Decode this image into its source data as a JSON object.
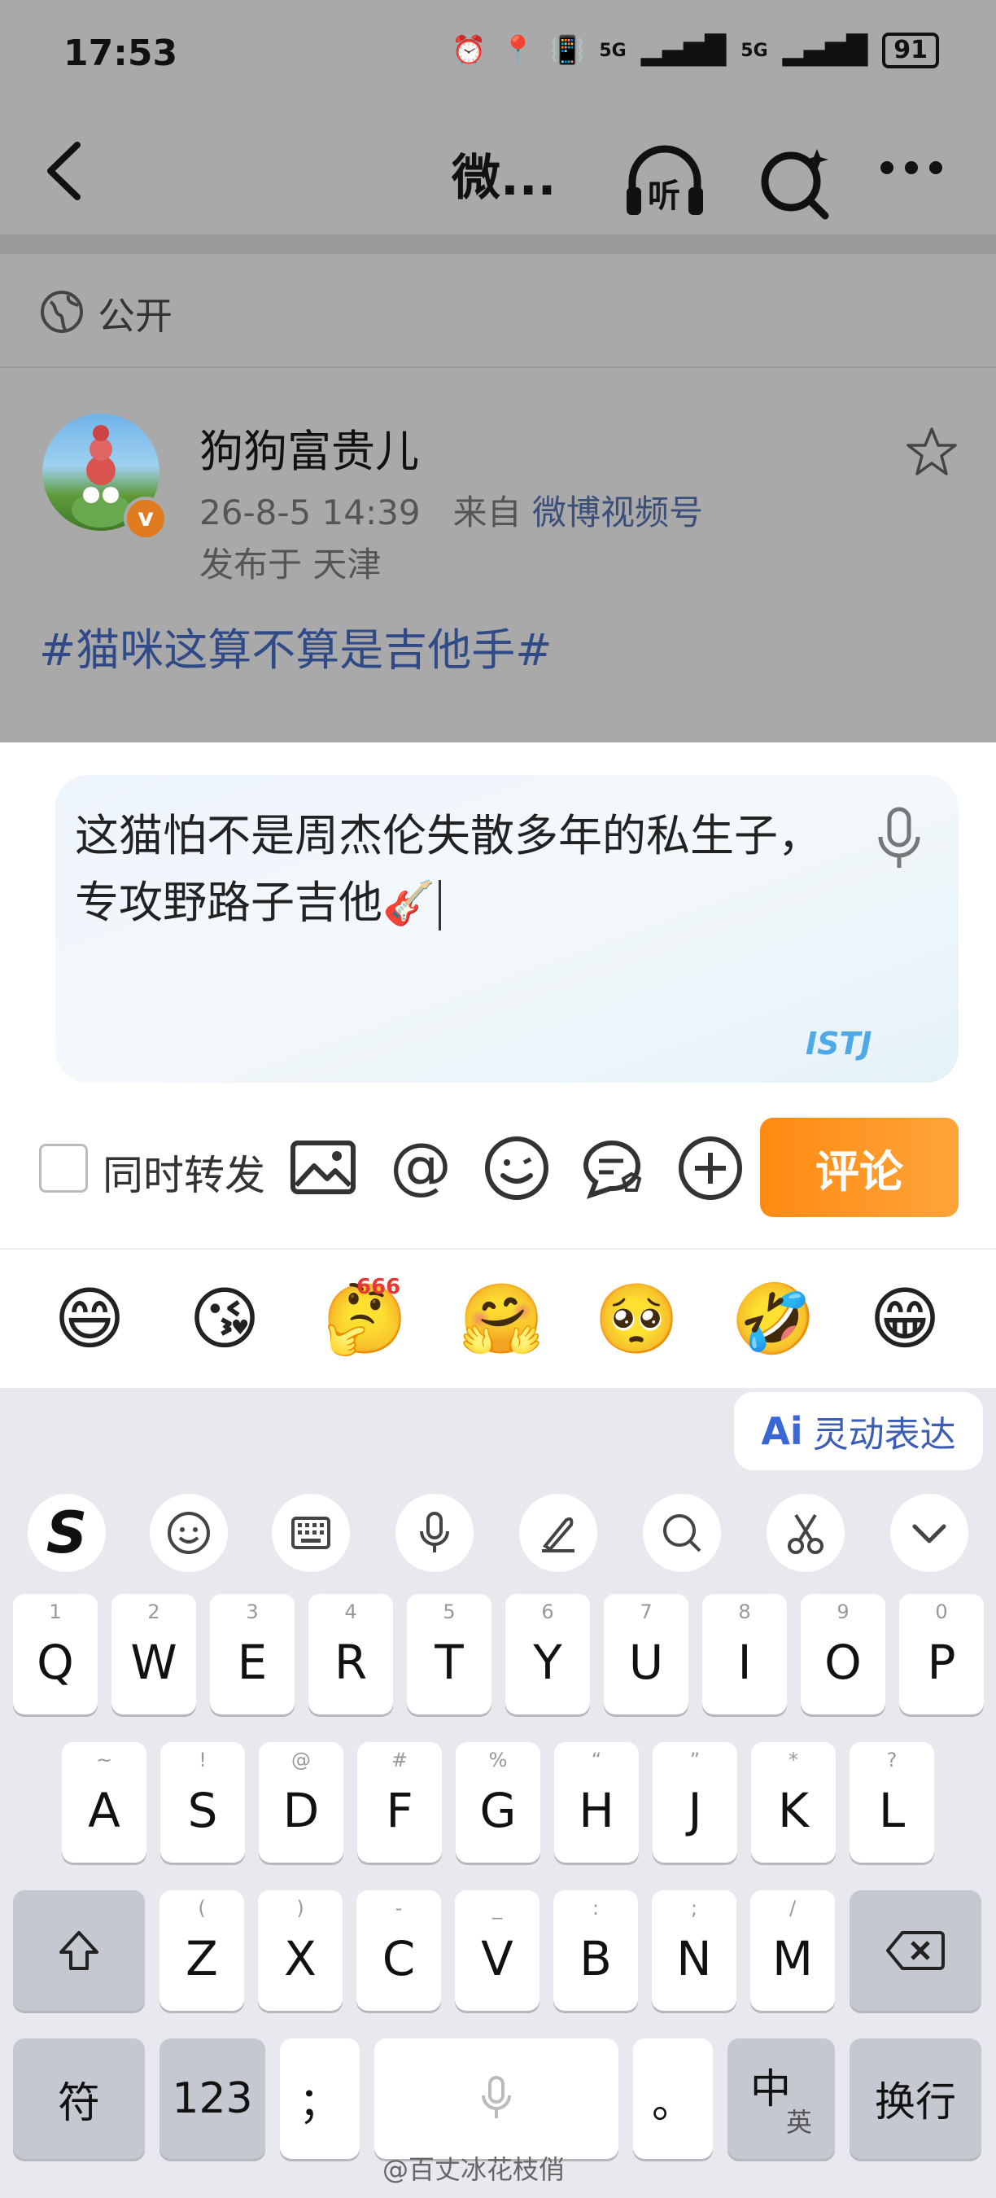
{
  "status_bar": {
    "time": "17:53",
    "signal1": "5G",
    "signal2": "5G",
    "battery": "91"
  },
  "nav": {
    "title": "微...",
    "listen_label": "听"
  },
  "post": {
    "visibility": "公开",
    "username": "狗狗富贵儿",
    "date": "26-8-5 14:39",
    "from_prefix": "来自",
    "source": "微博视频号",
    "location": "发布于 天津",
    "hashtag": "#猫咪这算不算是吉他手#"
  },
  "composer": {
    "text": "这猫怕不是周杰伦失散多年的私生子，专攻野路子吉他",
    "emoji": "🎸",
    "badge": "ISTJ",
    "repost_label": "同时转发",
    "repost_checked": false,
    "submit_label": "评论"
  },
  "emoji_bar": [
    "😄",
    "😘",
    "🤔",
    "🤗",
    "🥺",
    "🤣",
    "😁"
  ],
  "emoji_badge": "666",
  "keyboard": {
    "ai_label": "灵动表达",
    "ai_icon": "Ai",
    "toolbar_icons": [
      "sogou-logo-icon",
      "emoji-icon",
      "keyboard-icon",
      "mic-icon",
      "handwriting-icon",
      "search-icon",
      "scissors-icon",
      "chevron-down-icon"
    ],
    "row1": [
      {
        "k": "Q",
        "h": "1"
      },
      {
        "k": "W",
        "h": "2"
      },
      {
        "k": "E",
        "h": "3"
      },
      {
        "k": "R",
        "h": "4"
      },
      {
        "k": "T",
        "h": "5"
      },
      {
        "k": "Y",
        "h": "6"
      },
      {
        "k": "U",
        "h": "7"
      },
      {
        "k": "I",
        "h": "8"
      },
      {
        "k": "O",
        "h": "9"
      },
      {
        "k": "P",
        "h": "0"
      }
    ],
    "row2": [
      {
        "k": "A",
        "h": "~"
      },
      {
        "k": "S",
        "h": "!"
      },
      {
        "k": "D",
        "h": "@"
      },
      {
        "k": "F",
        "h": "#"
      },
      {
        "k": "G",
        "h": "%"
      },
      {
        "k": "H",
        "h": "“"
      },
      {
        "k": "J",
        "h": "”"
      },
      {
        "k": "K",
        "h": "*"
      },
      {
        "k": "L",
        "h": "?"
      }
    ],
    "row3": [
      {
        "k": "Z",
        "h": "("
      },
      {
        "k": "X",
        "h": ")"
      },
      {
        "k": "C",
        "h": "-"
      },
      {
        "k": "V",
        "h": "_"
      },
      {
        "k": "B",
        "h": ":"
      },
      {
        "k": "N",
        "h": ";"
      },
      {
        "k": "M",
        "h": "/"
      }
    ],
    "symbols_label": "符",
    "numbers_label": "123",
    "semicolon_label": "；",
    "period_label": "。",
    "lang_main": "中",
    "lang_sub": "英",
    "enter_label": "换行"
  },
  "watermark": "@百丈冰花枝俏"
}
